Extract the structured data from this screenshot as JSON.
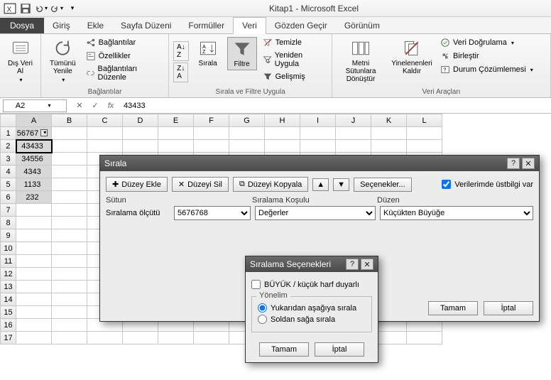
{
  "app": {
    "title": "Kitap1 - Microsoft Excel"
  },
  "tabs": {
    "file": "Dosya",
    "items": [
      "Giriş",
      "Ekle",
      "Sayfa Düzeni",
      "Formüller",
      "Veri",
      "Gözden Geçir",
      "Görünüm"
    ],
    "active_index": 4
  },
  "ribbon": {
    "group_external": {
      "btn": "Dış Veri Al",
      "label": ""
    },
    "group_connections": {
      "refresh": "Tümünü Yenile",
      "links": "Bağlantılar",
      "properties": "Özellikler",
      "edit_links": "Bağlantıları Düzenle",
      "label": "Bağlantılar"
    },
    "group_sort": {
      "sort": "Sırala",
      "filter": "Filtre",
      "clear": "Temizle",
      "reapply": "Yeniden Uygula",
      "advanced": "Gelişmiş",
      "label": "Sırala ve Filtre Uygula"
    },
    "group_datatools": {
      "text_to_cols": "Metni Sütunlara Dönüştür",
      "remove_dups": "Yinelenenleri Kaldır",
      "validation": "Veri Doğrulama",
      "consolidate": "Birleştir",
      "whatif": "Durum Çözümlemesi",
      "label": "Veri Araçları"
    }
  },
  "formula_bar": {
    "name": "A2",
    "fx": "fx",
    "value": "43433"
  },
  "sheet": {
    "cols": [
      "A",
      "B",
      "C",
      "D",
      "E",
      "F",
      "G",
      "H",
      "I",
      "J",
      "K",
      "L"
    ],
    "rows": [
      1,
      2,
      3,
      4,
      5,
      6,
      7,
      8,
      9,
      10,
      11,
      12,
      13,
      14,
      15,
      16,
      17
    ],
    "data": {
      "A1": "56767",
      "A2": "43433",
      "A3": "34556",
      "A4": "4343",
      "A5": "1133",
      "A6": "232"
    },
    "active_cell": "A2",
    "selected_col": "A",
    "filtered_header": "A1"
  },
  "dialog_sort": {
    "title": "Sırala",
    "add_level": "Düzey Ekle",
    "delete_level": "Düzeyi Sil",
    "copy_level": "Düzeyi Kopyala",
    "options": "Seçenekler...",
    "headers_chk": "Verilerimde üstbilgi var",
    "col_header": "Sütun",
    "criteria_header": "Sıralama Koşulu",
    "order_header": "Düzen",
    "sortby_label": "Sıralama ölçütü",
    "sortby_value": "5676768",
    "criteria_value": "Değerler",
    "order_value": "Küçükten Büyüğe",
    "ok": "Tamam",
    "cancel": "İptal"
  },
  "dialog_options": {
    "title": "Sıralama Seçenekleri",
    "case_sensitive": "BÜYÜK / küçük harf duyarlı",
    "orientation_legend": "Yönelim",
    "top_to_bottom": "Yukarıdan aşağıya sırala",
    "left_to_right": "Soldan sağa sırala",
    "ok": "Tamam",
    "cancel": "İptal"
  }
}
